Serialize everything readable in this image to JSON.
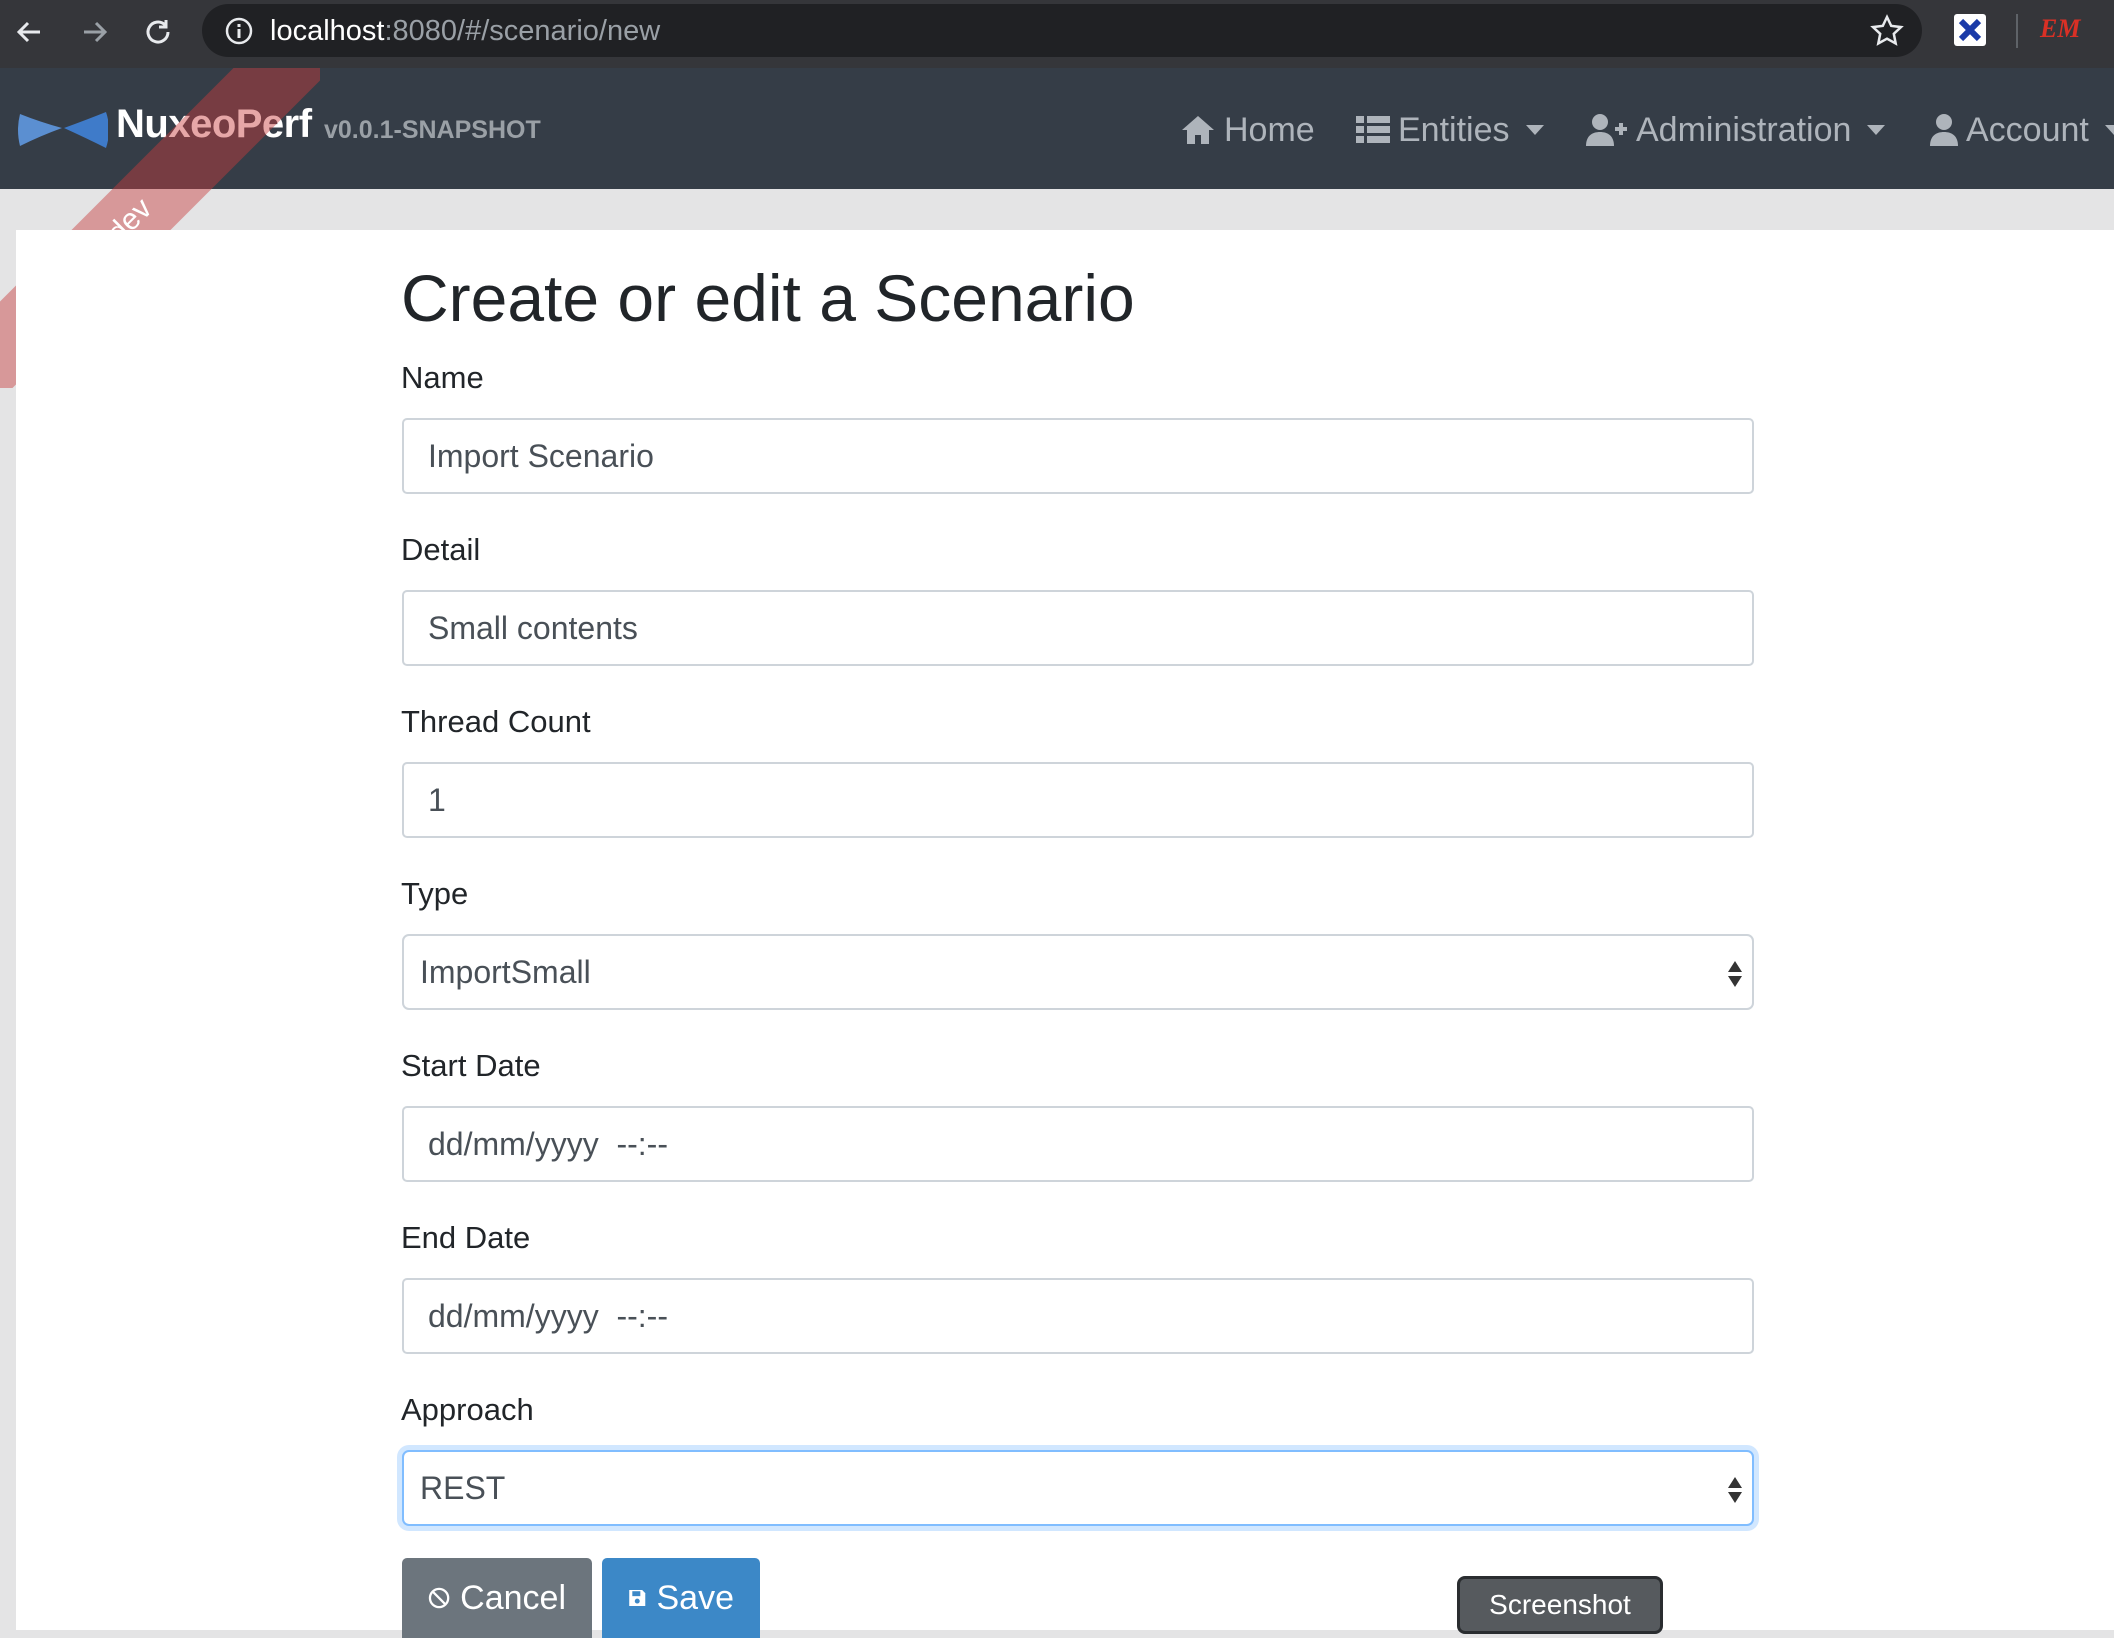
{
  "browser": {
    "url_host": "localhost",
    "url_path": ":8080/#/scenario/new",
    "extension_em_label": "EM"
  },
  "navbar": {
    "brand_name": "NuxeoPerf",
    "version": "v0.0.1-SNAPSHOT",
    "ribbon_label": "dev",
    "items": [
      {
        "label": "Home",
        "icon": "home-icon"
      },
      {
        "label": "Entities",
        "icon": "list-icon"
      },
      {
        "label": "Administration",
        "icon": "user-plus-icon"
      },
      {
        "label": "Account",
        "icon": "user-icon"
      }
    ]
  },
  "form": {
    "title": "Create or edit a Scenario",
    "name": {
      "label": "Name",
      "value": "Import Scenario"
    },
    "detail": {
      "label": "Detail",
      "value": "Small contents"
    },
    "thread_count": {
      "label": "Thread Count",
      "value": "1"
    },
    "type": {
      "label": "Type",
      "selected": "ImportSmall"
    },
    "start_date": {
      "label": "Start Date",
      "placeholder": "dd/mm/yyyy  --:--"
    },
    "end_date": {
      "label": "End Date",
      "placeholder": "dd/mm/yyyy  --:--"
    },
    "approach": {
      "label": "Approach",
      "selected": "REST"
    }
  },
  "buttons": {
    "cancel": "Cancel",
    "save": "Save",
    "screenshot": "Screenshot"
  },
  "colors": {
    "navbar_bg": "#353d47",
    "save_button": "#3c88c7",
    "cancel_button": "#6c757d",
    "ribbon": "#c83c3c"
  }
}
